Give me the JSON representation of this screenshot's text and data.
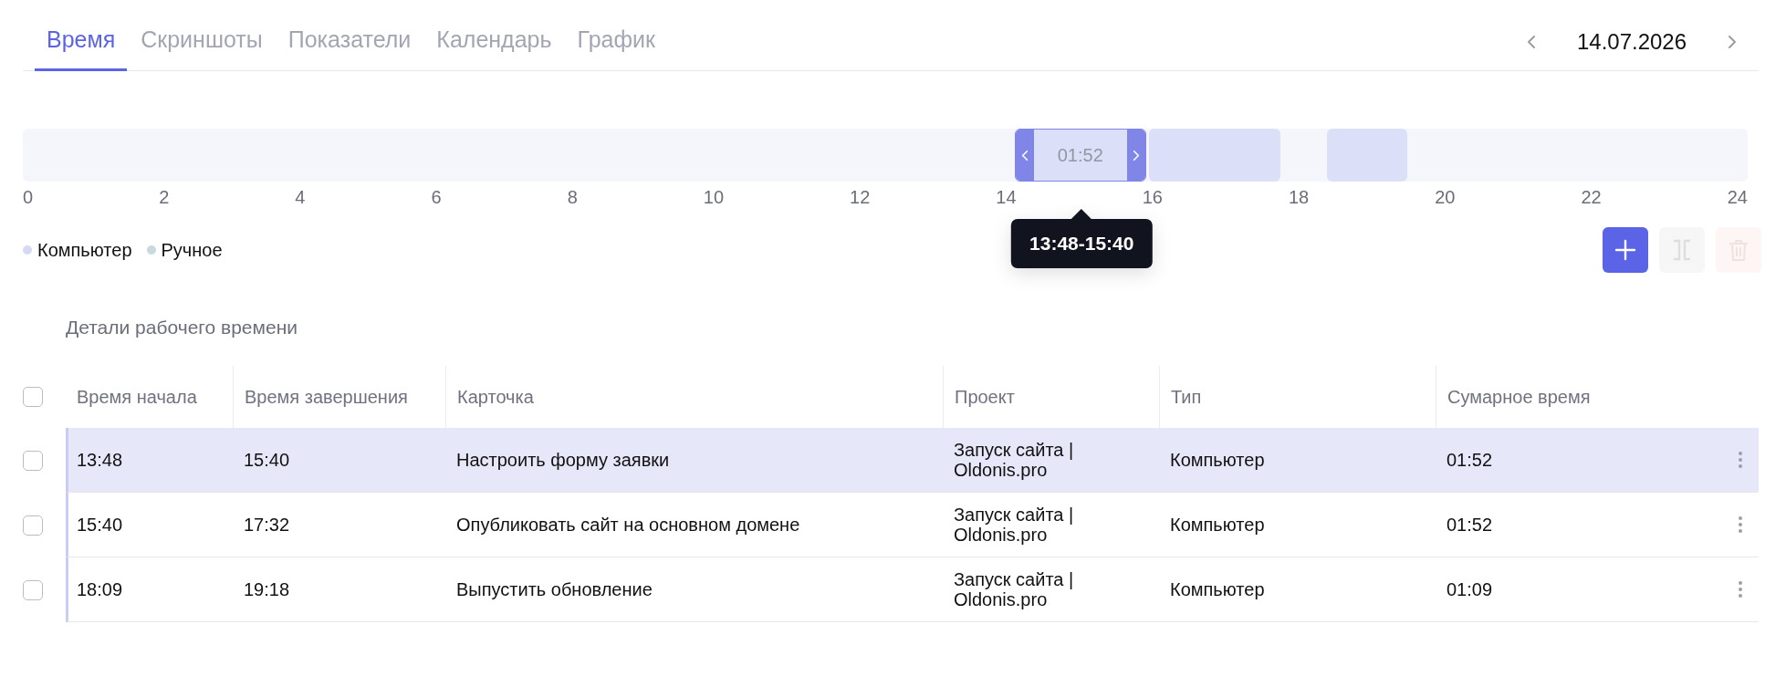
{
  "tabs": [
    {
      "label": "Время",
      "selected": true
    },
    {
      "label": "Скриншоты",
      "selected": false
    },
    {
      "label": "Показатели",
      "selected": false
    },
    {
      "label": "Календарь",
      "selected": false
    },
    {
      "label": "График",
      "selected": false
    }
  ],
  "date_nav": {
    "date": "14.07.2026"
  },
  "timeline": {
    "ticks": [
      "0",
      "2",
      "4",
      "6",
      "8",
      "10",
      "12",
      "14",
      "16",
      "18",
      "20",
      "22",
      "24"
    ],
    "selected_duration": "01:52",
    "tooltip": "13:48-15:40"
  },
  "legend": [
    {
      "label": "Компьютер",
      "color": "#d6d9f6"
    },
    {
      "label": "Ручное",
      "color": "#c9d9e0"
    }
  ],
  "actions": [
    {
      "kind": "add",
      "disabled": false
    },
    {
      "kind": "split",
      "disabled": true
    },
    {
      "kind": "delete",
      "disabled": true
    }
  ],
  "section_title": "Детали рабочего времени",
  "table": {
    "select_all_checked": false,
    "columns": [
      "Время начала",
      "Время завершения",
      "Карточка",
      "Проект",
      "Тип",
      "Сумарное время"
    ],
    "rows": [
      {
        "selected": true,
        "checked": false,
        "start": "13:48",
        "end": "15:40",
        "card": "Настроить форму заявки",
        "project": "Запуск сайта | Oldonis.pro",
        "type": "Компьютер",
        "total": "01:52"
      },
      {
        "selected": false,
        "checked": false,
        "start": "15:40",
        "end": "17:32",
        "card": "Опубликовать сайт на основном домене",
        "project": "Запуск сайта | Oldonis.pro",
        "type": "Компьютер",
        "total": "01:52"
      },
      {
        "selected": false,
        "checked": false,
        "start": "18:09",
        "end": "19:18",
        "card": "Выпустить обновление",
        "project": "Запуск сайта | Oldonis.pro",
        "type": "Компьютер",
        "total": "01:09"
      }
    ]
  }
}
